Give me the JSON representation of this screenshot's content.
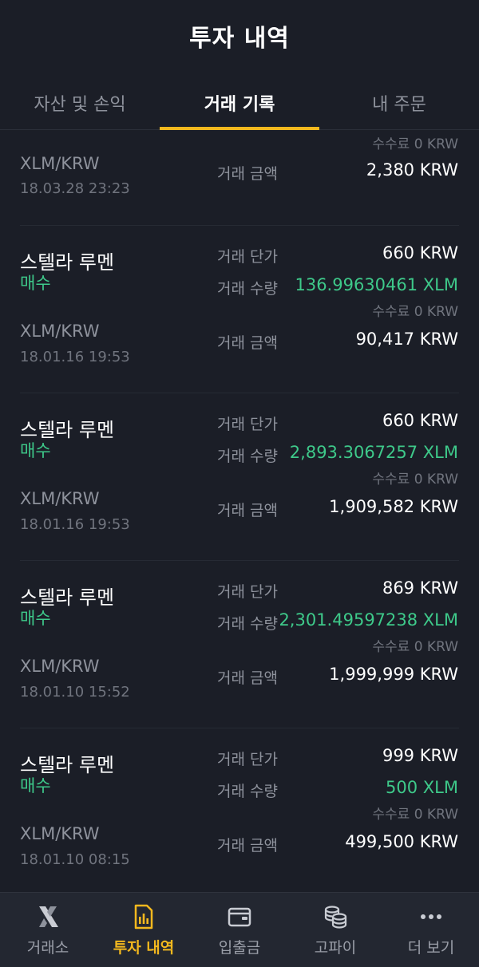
{
  "header": {
    "title": "투자 내역"
  },
  "tabs": [
    {
      "label": "자산 및 손익"
    },
    {
      "label": "거래 기록"
    },
    {
      "label": "내 주문"
    }
  ],
  "labels": {
    "price": "거래 단가",
    "qty": "거래 수량",
    "amount": "거래 금액"
  },
  "partial": {
    "fee": "수수료 0 KRW",
    "pair": "XLM/KRW",
    "datetime": "18.03.28 23:23",
    "amount": "2,380 KRW"
  },
  "trades": [
    {
      "name": "스텔라 루멘",
      "side": "매수",
      "pair": "XLM/KRW",
      "datetime": "18.01.16 19:53",
      "price": "660 KRW",
      "qty": "136.99630461 XLM",
      "fee": "수수료 0 KRW",
      "amount": "90,417 KRW"
    },
    {
      "name": "스텔라 루멘",
      "side": "매수",
      "pair": "XLM/KRW",
      "datetime": "18.01.16 19:53",
      "price": "660 KRW",
      "qty": "2,893.3067257 XLM",
      "fee": "수수료 0 KRW",
      "amount": "1,909,582 KRW"
    },
    {
      "name": "스텔라 루멘",
      "side": "매수",
      "pair": "XLM/KRW",
      "datetime": "18.01.10 15:52",
      "price": "869 KRW",
      "qty": "2,301.49597238 XLM",
      "fee": "수수료 0 KRW",
      "amount": "1,999,999 KRW"
    },
    {
      "name": "스텔라 루멘",
      "side": "매수",
      "pair": "XLM/KRW",
      "datetime": "18.01.10 08:15",
      "price": "999 KRW",
      "qty": "500 XLM",
      "fee": "수수료 0 KRW",
      "amount": "499,500 KRW"
    }
  ],
  "nav": [
    {
      "label": "거래소",
      "icon": "exchange-x-icon"
    },
    {
      "label": "투자 내역",
      "icon": "chart-document-icon"
    },
    {
      "label": "입출금",
      "icon": "wallet-icon"
    },
    {
      "label": "고파이",
      "icon": "coins-icon"
    },
    {
      "label": "더 보기",
      "icon": "more-dots-icon"
    }
  ],
  "colors": {
    "accent": "#f3b81e",
    "buy": "#3ec98a",
    "background": "#1b1e27"
  }
}
